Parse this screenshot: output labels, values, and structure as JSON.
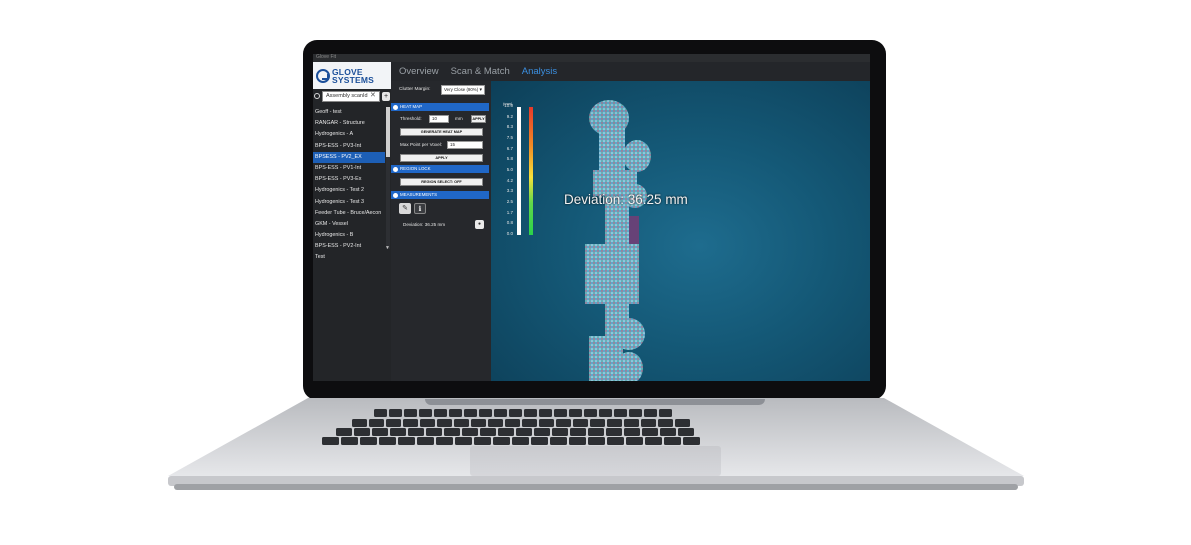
{
  "window": {
    "title": "Glove Fit"
  },
  "logo": {
    "text_line1": "GLOVE",
    "text_line2": "SYSTEMS"
  },
  "nav": {
    "tabs": [
      {
        "label": "Overview"
      },
      {
        "label": "Scan & Match"
      },
      {
        "label": "Analysis"
      }
    ],
    "active_tab": "Analysis"
  },
  "sidebar": {
    "search": {
      "value": "Assembly scanId"
    },
    "items": [
      {
        "label": "Geoff - test"
      },
      {
        "label": "RANGAR - Structure"
      },
      {
        "label": "Hydrogenics - A"
      },
      {
        "label": "BPS-ESS - PV3-Int"
      },
      {
        "label": "BPSESS - PV2_EX",
        "selected": true
      },
      {
        "label": "BPS-ESS - PV1-Int"
      },
      {
        "label": "BPS-ESS - PV3-Ex"
      },
      {
        "label": "Hydrogenics - Test 2"
      },
      {
        "label": "Hydrogenics - Test 3"
      },
      {
        "label": "Feeder Tube - Bruce/Aecon"
      },
      {
        "label": "GKM - Vessel"
      },
      {
        "label": "Hydrogenics - B"
      },
      {
        "label": "BPS-ESS - PV2-Int"
      },
      {
        "label": "Test"
      }
    ]
  },
  "analysis_panel": {
    "clutter_margin": {
      "label": "Clutter Margin:",
      "value": "Very Close (90%)"
    },
    "heat_map": {
      "header": "HEAT MAP",
      "threshold_label": "Threshold:",
      "threshold_value": "10",
      "threshold_unit": "mm",
      "apply_label": "APPLY",
      "generate_label": "GENERATE HEAT MAP",
      "max_point_label": "Max Point per Voxel:",
      "max_point_value": "15",
      "apply2_label": "APPLY"
    },
    "region_lock": {
      "header": "REGION LOCK",
      "button_label": "REGION SELECT: OFF"
    },
    "measurements": {
      "header": "MEASUREMENTS",
      "deviation_text": "Deviation: 36.25 mm"
    }
  },
  "viewport": {
    "colorbar": {
      "unit": "(mm)",
      "ticks": [
        "10.0",
        "9.2",
        "8.3",
        "7.5",
        "6.7",
        "5.8",
        "5.0",
        "4.2",
        "3.3",
        "2.5",
        "1.7",
        "0.8",
        "0.0"
      ]
    },
    "deviation_label": "Deviation: 36.25 mm"
  }
}
